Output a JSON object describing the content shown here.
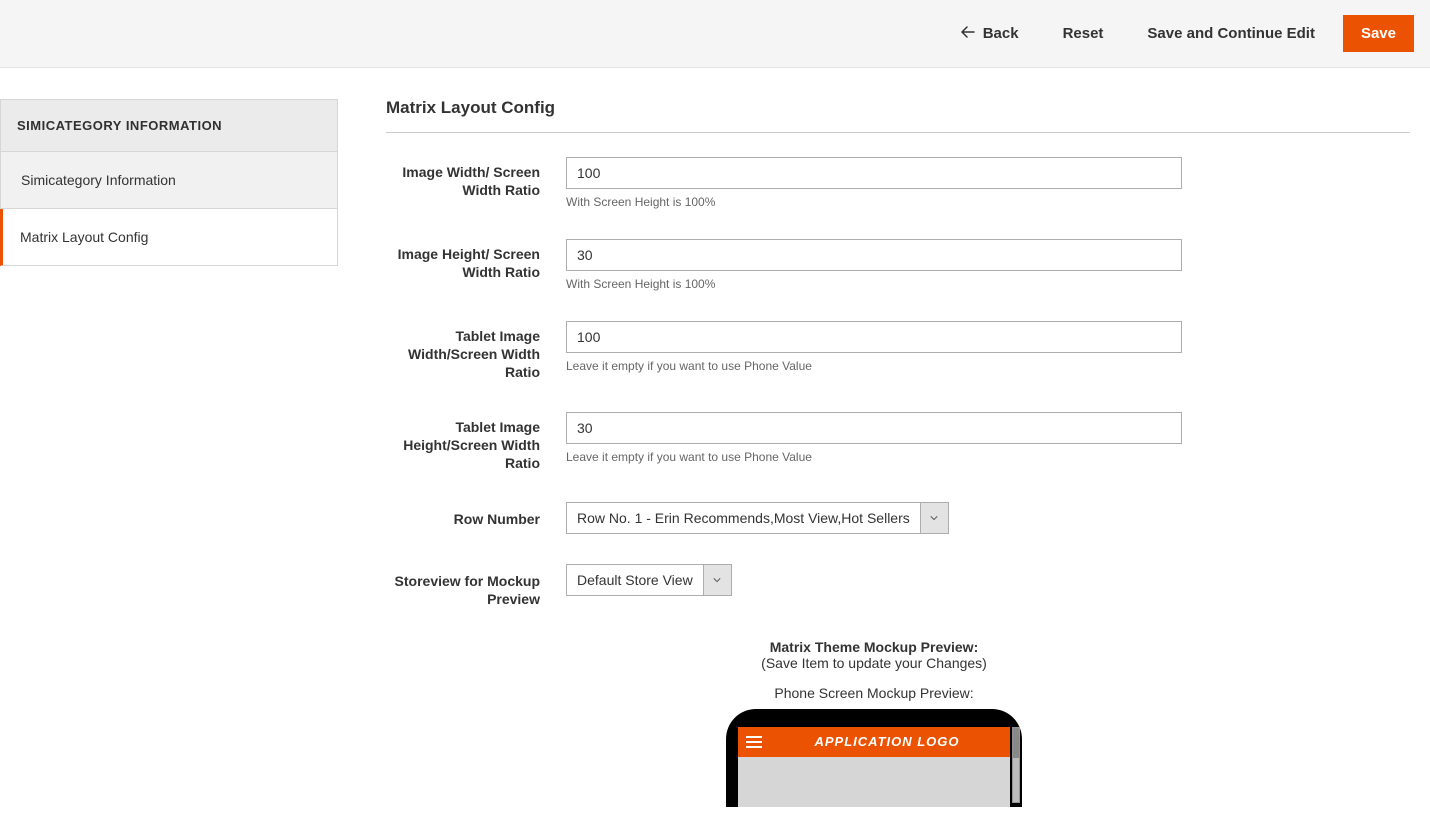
{
  "topbar": {
    "back": "Back",
    "reset": "Reset",
    "saveContinue": "Save and Continue Edit",
    "save": "Save"
  },
  "sidebar": {
    "title": "SIMICATEGORY INFORMATION",
    "items": [
      {
        "label": "Simicategory Information"
      },
      {
        "label": "Matrix Layout Config"
      }
    ]
  },
  "main": {
    "title": "Matrix Layout Config",
    "fields": {
      "imageWidth": {
        "label": "Image Width/ Screen Width Ratio",
        "value": "100",
        "note": "With Screen Height is 100%"
      },
      "imageHeight": {
        "label": "Image Height/ Screen Width Ratio",
        "value": "30",
        "note": "With Screen Height is 100%"
      },
      "tabletWidth": {
        "label": "Tablet Image Width/Screen Width Ratio",
        "value": "100",
        "note": "Leave it empty if you want to use Phone Value"
      },
      "tabletHeight": {
        "label": "Tablet Image Height/Screen Width Ratio",
        "value": "30",
        "note": "Leave it empty if you want to use Phone Value"
      },
      "rowNumber": {
        "label": "Row Number",
        "value": "Row No. 1 - Erin Recommends,Most View,Hot Sellers"
      },
      "storeview": {
        "label": "Storeview for Mockup Preview",
        "value": "Default Store View"
      }
    },
    "preview": {
      "title": "Matrix Theme Mockup Preview:",
      "subtitle": "(Save Item to update your Changes)",
      "phoneLabel": "Phone Screen Mockup Preview:",
      "appLogo": "APPLICATION LOGO"
    }
  }
}
